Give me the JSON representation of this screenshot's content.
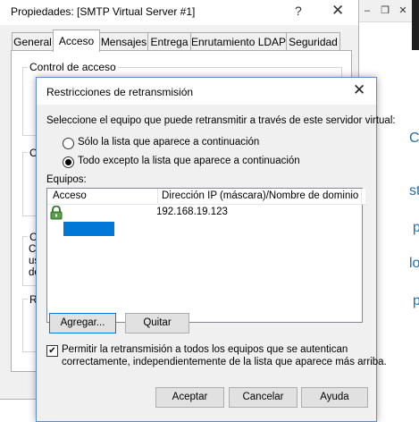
{
  "parent_window": {
    "title": "Propiedades: [SMTP Virtual Server #1]",
    "help_label": "?",
    "close_label": "✕",
    "tabs": [
      {
        "label": "General"
      },
      {
        "label": "Acceso"
      },
      {
        "label": "Mensajes"
      },
      {
        "label": "Entrega"
      },
      {
        "label": "Enrutamiento LDAP"
      },
      {
        "label": "Seguridad"
      }
    ],
    "active_tab": "Acceso",
    "group_access_control": "Control de acceso",
    "group_c2_label": "C",
    "group_c3_label": "C",
    "group_c3_lines": [
      "Co",
      "us",
      "do"
    ],
    "group_r_label": "R"
  },
  "background_app": {
    "minimize": "–",
    "restore": "❐",
    "close": "✕",
    "letters": [
      "C",
      "st",
      "p",
      "lo",
      "p"
    ]
  },
  "dialog": {
    "title": "Restricciones de retransmisión",
    "close_label": "✕",
    "prompt": "Seleccione el equipo que puede retransmitir a través de este servidor virtual:",
    "option_only_list": "Sólo la lista que aparece a continuación",
    "option_all_except": "Todo excepto la lista que aparece a continuación",
    "selected_option": "all_except",
    "computers_label": "Equipos:",
    "list": {
      "columns": [
        "Acceso",
        "Dirección IP (máscara)/Nombre de dominio"
      ],
      "rows": [
        {
          "access": "Denegado",
          "address": "192.168.19.123"
        }
      ]
    },
    "add_button": "Agregar...",
    "remove_button": "Quitar",
    "allow_auth_checked": true,
    "allow_auth_text_line1": "Permitir la retransmisión a todos los equipos que se autentican",
    "allow_auth_text_line2": "correctamente, independientemente de la lista que aparece más arriba.",
    "ok_button": "Aceptar",
    "cancel_button": "Cancelar",
    "help_button": "Ayuda"
  },
  "colors": {
    "selection": "#0078d7",
    "dialog_border": "#5a8dd6",
    "window_bg": "#f0f0f0"
  }
}
